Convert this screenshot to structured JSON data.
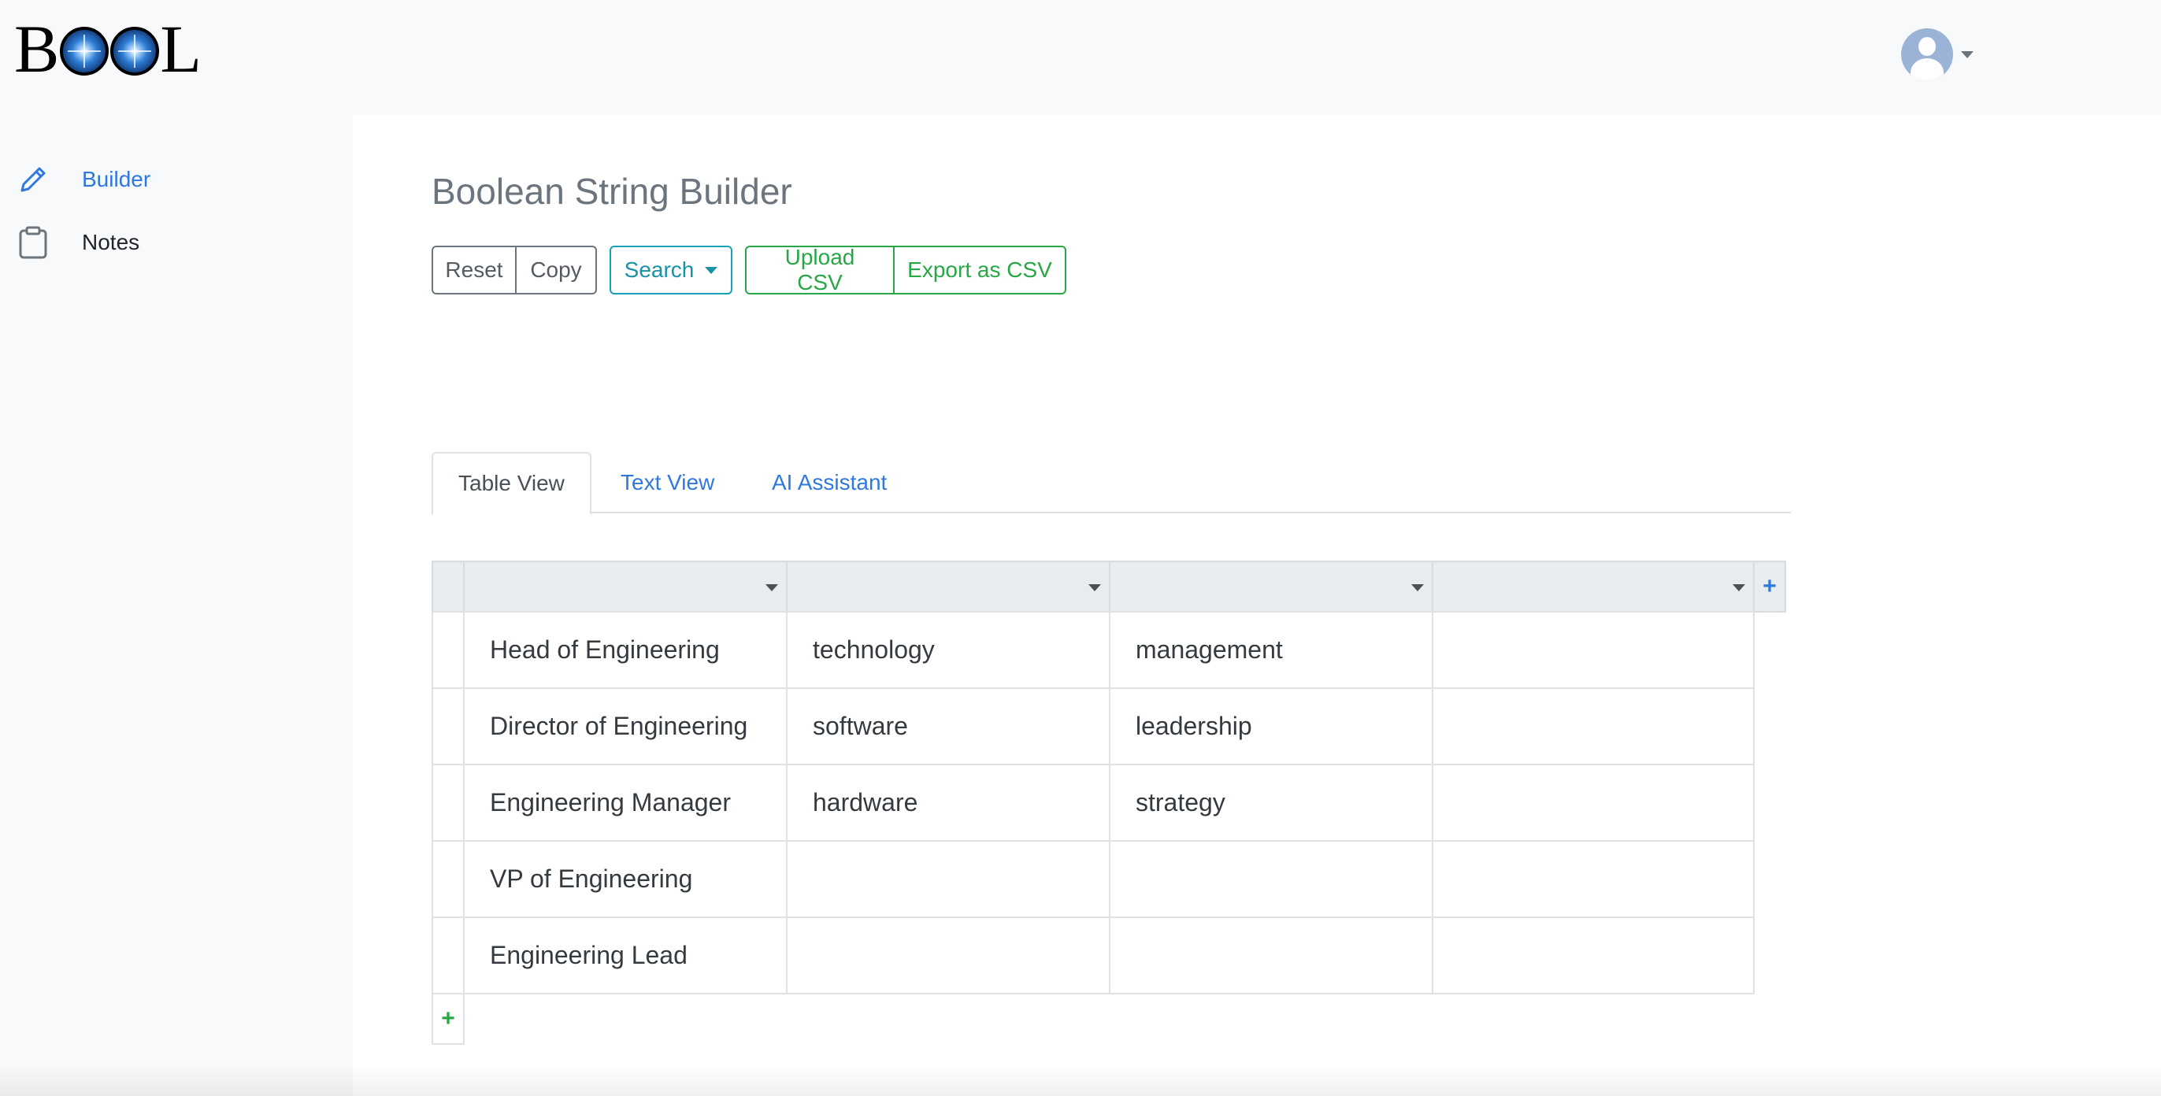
{
  "logo": {
    "text": "BOOL"
  },
  "sidebar": {
    "items": [
      {
        "label": "Builder",
        "icon": "pencil-icon",
        "active": true
      },
      {
        "label": "Notes",
        "icon": "clipboard-icon",
        "active": false
      }
    ]
  },
  "user_menu": {
    "icon": "user-avatar-icon"
  },
  "main": {
    "title": "Boolean String Builder",
    "toolbar": {
      "reset_label": "Reset",
      "copy_label": "Copy",
      "search_label": "Search",
      "upload_label": "Upload CSV",
      "export_label": "Export as CSV"
    },
    "tabs": [
      {
        "label": "Table View",
        "active": true
      },
      {
        "label": "Text View",
        "active": false
      },
      {
        "label": "AI Assistant",
        "active": false
      }
    ],
    "table": {
      "add_column_label": "+",
      "add_row_label": "+",
      "headers": [
        "",
        "",
        "",
        ""
      ],
      "rows": [
        [
          "Head of Engineering",
          "technology",
          "management",
          ""
        ],
        [
          "Director of Engineering",
          "software",
          "leadership",
          ""
        ],
        [
          "Engineering Manager",
          "hardware",
          "strategy",
          ""
        ],
        [
          "VP of Engineering",
          "",
          "",
          ""
        ],
        [
          "Engineering Lead",
          "",
          "",
          ""
        ]
      ]
    }
  },
  "colors": {
    "primary": "#2f78e0",
    "info": "#17a2b8",
    "success": "#28a745",
    "secondary": "#6c757d"
  }
}
